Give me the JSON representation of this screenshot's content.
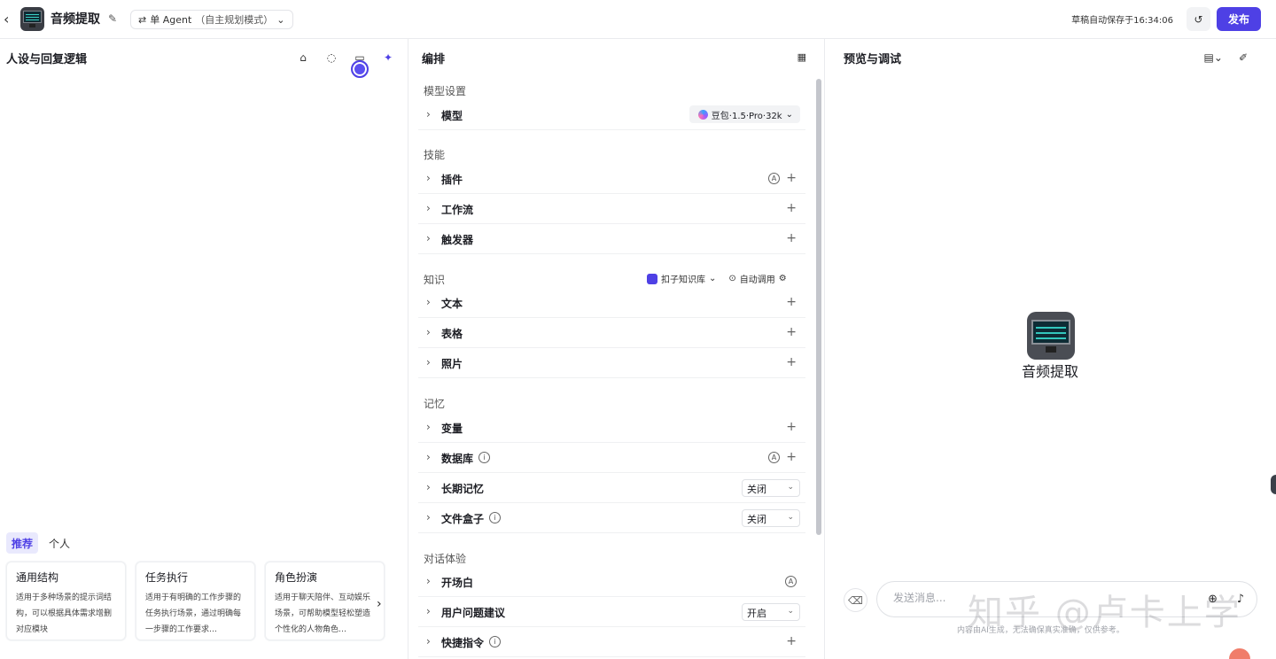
{
  "topbar": {
    "app_title": "音频提取",
    "agent_mode": "单 Agent",
    "agent_mode_sub": "（自主规划模式）",
    "saved_status": "草稿自动保存于16:34:06",
    "publish_label": "发布"
  },
  "left": {
    "title": "人设与回复逻辑",
    "tabs": [
      "推荐",
      "个人"
    ],
    "cards": [
      {
        "title": "通用结构",
        "desc": "适用于多种场景的提示词结构，可以根据具体需求增删对应模块"
      },
      {
        "title": "任务执行",
        "desc": "适用于有明确的工作步骤的任务执行场景，通过明确每一步骤的工作要求…"
      },
      {
        "title": "角色扮演",
        "desc": "适用于聊天陪伴、互动娱乐场景，可帮助模型轻松塑造个性化的人物角色…"
      }
    ]
  },
  "mid": {
    "title": "编排",
    "sections": {
      "model": "模型设置",
      "skills": "技能",
      "knowledge": "知识",
      "memory": "记忆",
      "dialog": "对话体验"
    },
    "rows": {
      "model": "模型",
      "plugin": "插件",
      "workflow": "工作流",
      "trigger": "触发器",
      "text": "文本",
      "table": "表格",
      "photo": "照片",
      "variable": "变量",
      "database": "数据库",
      "longterm": "长期记忆",
      "filebox": "文件盒子",
      "opening": "开场白",
      "suggest": "用户问题建议",
      "shortcut": "快捷指令"
    },
    "model_name": "豆包·1.5·Pro·32k",
    "kb_source": "扣子知识库",
    "auto_call": "自动调用",
    "longterm_value": "关闭",
    "filebox_value": "关闭",
    "suggest_value": "开启"
  },
  "right": {
    "title": "预览与调试",
    "bot_name": "音频提取",
    "input_placeholder": "发送消息...",
    "disclaimer": "内容由AI生成，无法确保真实准确，仅供参考。",
    "watermark": "知乎 @卢卡上学"
  }
}
